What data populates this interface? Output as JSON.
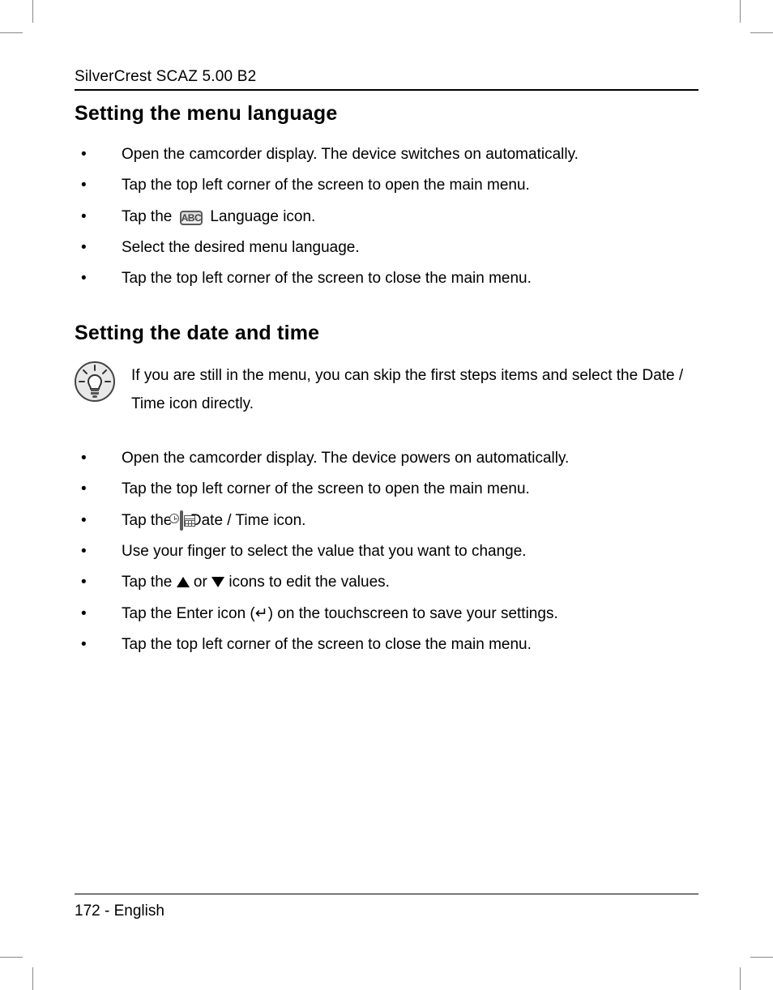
{
  "header": {
    "running_title": "SilverCrest SCAZ 5.00 B2"
  },
  "section1": {
    "heading": "Setting the menu language",
    "items": {
      "i0": "Open the camcorder display. The device switches on automatically.",
      "i1": "Tap the top left corner of the screen to open the main menu.",
      "i2_pre": "Tap the ",
      "i2_icon_label": "ABC",
      "i2_post": " Language icon.",
      "i3": "Select the desired menu language.",
      "i4": "Tap the top left corner of the screen to close the main menu."
    }
  },
  "section2": {
    "heading": "Setting the date and time",
    "tip": "If you are still in the menu, you can skip the first steps items and select the Date / Time icon directly.",
    "items": {
      "i0": "Open the camcorder display. The device powers on automatically.",
      "i1": "Tap the top left corner of the screen to open the main menu.",
      "i2_pre": "Tap the ",
      "i2_post": " Date / Time icon.",
      "i3": "Use your finger to select the value that you want to change.",
      "i4_pre": "Tap the ",
      "i4_mid": " or ",
      "i4_post": " icons to edit the values.",
      "i5_pre": "Tap the Enter icon (",
      "i5_glyph": "↵",
      "i5_post": ") on the touchscreen to save your settings.",
      "i6": "Tap the top left corner of the screen to close the main menu."
    }
  },
  "footer": {
    "page_label": "172 - English"
  }
}
